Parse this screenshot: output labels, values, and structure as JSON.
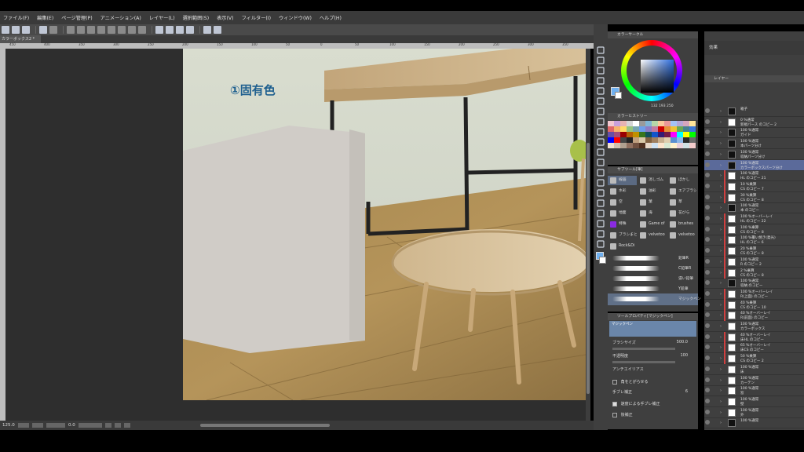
{
  "menu": [
    "ファイル(F)",
    "編集(E)",
    "ページ管理(P)",
    "アニメーション(A)",
    "レイヤー(L)",
    "選択範囲(S)",
    "表示(V)",
    "フィルター(I)",
    "ウィンドウ(W)",
    "ヘルプ(H)"
  ],
  "document_tab": "カラーボックス2 *",
  "ruler_ticks": [
    "450",
    "400",
    "350",
    "300",
    "250",
    "200",
    "150",
    "100",
    "50",
    "0",
    "50",
    "100",
    "150",
    "200",
    "250",
    "300",
    "350"
  ],
  "canvas": {
    "annotation": "①固有色"
  },
  "status": {
    "zoom": "125.0",
    "angle": "0.0"
  },
  "color_panel": {
    "title": "カラーサークル",
    "rgb_readout": "132 193 250"
  },
  "history_panel": {
    "title": "カラーヒストリー"
  },
  "subtool_panel": {
    "title": "サブツール[筆]",
    "categories": [
      "線画",
      "消しゴム",
      "ぼかし",
      "水彩",
      "油彩",
      "エアブラシ",
      "空",
      "葉",
      "草",
      "地面",
      "海",
      "花びら",
      "特殊",
      "Game of",
      "brushes",
      "ブラシまとめ",
      "velvetoo",
      "velvetoo",
      "Rock&Di"
    ],
    "brushes": [
      "鉛筆R",
      "C鉛筆R",
      "濃い鉛筆",
      "Y鉛筆",
      "マジックペン"
    ]
  },
  "tool_property": {
    "title": "ツールプロパティ[マジックペン]",
    "preview_label": "マジックペン",
    "brush_size_label": "ブラシサイズ",
    "brush_size": "500.0",
    "opacity_label": "不透明度",
    "opacity": "100",
    "antialias_label": "アンチエイリアス",
    "sharp_corners": "角をとがらせる",
    "stabilization_label": "手ブレ補正",
    "stabilization": "6",
    "speed_stab": "速度による手ブレ補正",
    "post_correction": "後補正"
  },
  "layer_panel": {
    "effect_label": "効果",
    "tabs_label": "レイヤー",
    "layers": [
      {
        "l1": "箱子",
        "l2": ""
      },
      {
        "l1": "0 %通常",
        "l2": "新規パース のコピー 2"
      },
      {
        "l1": "100 %通常",
        "l2": "ガイド"
      },
      {
        "l1": "100 %通常",
        "l2": "本パーツ分け"
      },
      {
        "l1": "100 %通常",
        "l2": "収納パーツ分け"
      },
      {
        "l1": "100 %通常",
        "l2": "カラーボックスパーツ分け"
      },
      {
        "l1": "100 %通常",
        "l2": "HL のコピー 21"
      },
      {
        "l1": "10 %乗算",
        "l2": "CS のコピー 7"
      },
      {
        "l1": "30 %乗算",
        "l2": "CS のコピー 8"
      },
      {
        "l1": "100 %通常",
        "l2": "本 のコピー"
      },
      {
        "l1": "100 %オーバーレイ",
        "l2": "HL のコピー 22"
      },
      {
        "l1": "100 %乗算",
        "l2": "CS のコピー 8"
      },
      {
        "l1": "100 %覆い焼き(発光)",
        "l2": "HL のコピー 6"
      },
      {
        "l1": "20 %乗算",
        "l2": "CS のコピー 8"
      },
      {
        "l1": "100 %通常",
        "l2": "R のコピー 2"
      },
      {
        "l1": "2 %乗算",
        "l2": "CS のコピー 8"
      },
      {
        "l1": "100 %通常",
        "l2": "収納 のコピー"
      },
      {
        "l1": "100 %オーバーレイ",
        "l2": "R(上面) のコピー"
      },
      {
        "l1": "40 %乗算",
        "l2": "CS のコピー 10"
      },
      {
        "l1": "40 %オーバーレイ",
        "l2": "R(前面) のコピー"
      },
      {
        "l1": "100 %通常",
        "l2": "カラーボックス"
      },
      {
        "l1": "40 %オーバーレイ",
        "l2": "床HL のコピー"
      },
      {
        "l1": "65 %オーバーレイ",
        "l2": "床CS のコピー"
      },
      {
        "l1": "50 %乗算",
        "l2": "CS のコピー 2"
      },
      {
        "l1": "100 %通常",
        "l2": "床"
      },
      {
        "l1": "100 %通常",
        "l2": "カーテン"
      },
      {
        "l1": "100 %通常",
        "l2": "窓"
      },
      {
        "l1": "100 %通常",
        "l2": "壁"
      },
      {
        "l1": "100 %通常",
        "l2": "外"
      },
      {
        "l1": "100 %通常",
        "l2": ""
      }
    ]
  },
  "colors": {
    "accent_blue": "#6fb0f0",
    "selected_layer": "#5b6a9a",
    "panel_bg": "#3f3f3f"
  }
}
